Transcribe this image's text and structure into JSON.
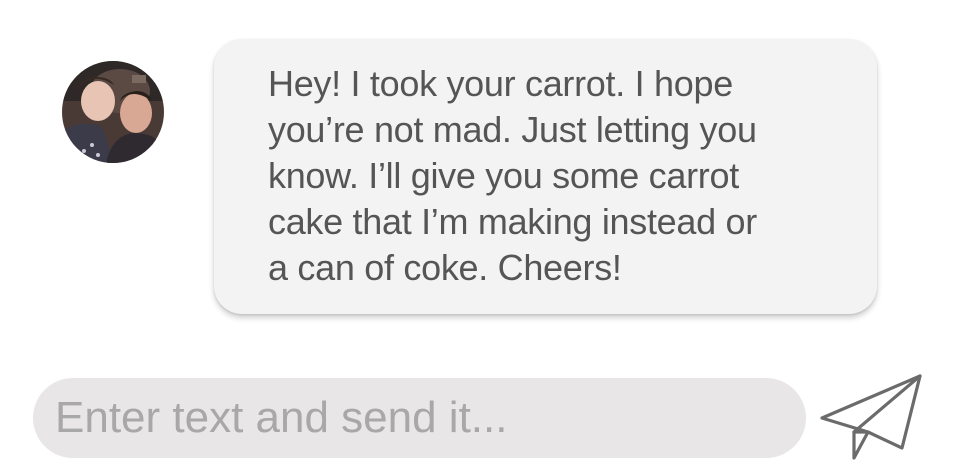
{
  "message": {
    "text": "Hey! I took your carrot. I hope\nyou’re not mad. Just letting you\nknow. I’ll give you some carrot\ncake that I’m making instead or\na can of coke. Cheers!"
  },
  "composer": {
    "placeholder": "Enter text and send it...",
    "value": ""
  },
  "icons": {
    "send": "paper-plane-icon"
  },
  "colors": {
    "bubble": "#f3f3f3",
    "bubble_text": "#555555",
    "composer_bg": "#e8e6e7",
    "placeholder": "#a8a8a8",
    "send_icon": "#6b6b6b"
  }
}
